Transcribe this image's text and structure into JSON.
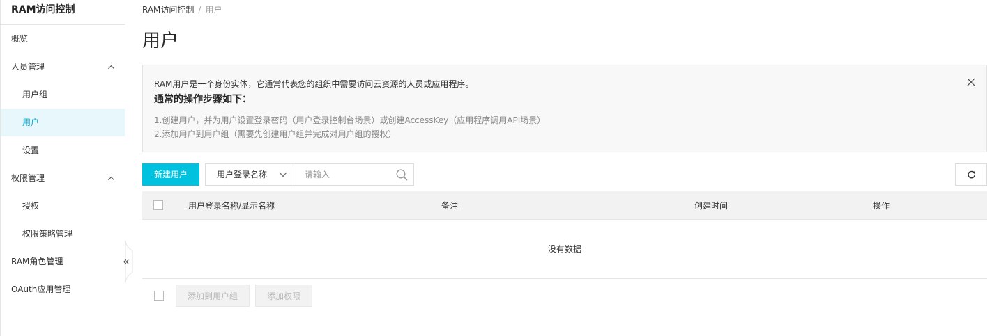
{
  "sidebar": {
    "title": "RAM访问控制",
    "items": [
      {
        "label": "概览"
      },
      {
        "label": "人员管理"
      },
      {
        "label": "用户组"
      },
      {
        "label": "用户"
      },
      {
        "label": "设置"
      },
      {
        "label": "权限管理"
      },
      {
        "label": "授权"
      },
      {
        "label": "权限策略管理"
      },
      {
        "label": "RAM角色管理"
      },
      {
        "label": "OAuth应用管理"
      }
    ],
    "collapse_glyph": "«"
  },
  "breadcrumb": {
    "root": "RAM访问控制",
    "separator": "/",
    "current": "用户"
  },
  "page": {
    "title": "用户"
  },
  "notice": {
    "description": "RAM用户是一个身份实体，它通常代表您的组织中需要访问云资源的人员或应用程序。",
    "heading": "通常的操作步骤如下：",
    "steps": [
      "1.创建用户，并为用户设置登录密码（用户登录控制台场景）或创建AccessKey（应用程序调用API场景）",
      "2.添加用户到用户组（需要先创建用户组并完成对用户组的授权）"
    ]
  },
  "toolbar": {
    "new_user": "新建用户",
    "filter_select": "用户登录名称",
    "search_placeholder": "请输入"
  },
  "table": {
    "columns": [
      "用户登录名称/显示名称",
      "备注",
      "创建时间",
      "操作"
    ],
    "empty_text": "没有数据"
  },
  "footer": {
    "add_to_group": "添加到用户组",
    "add_permission": "添加权限"
  },
  "colors": {
    "accent": "#00c1de",
    "active_bg": "#e8f7fb",
    "active_text": "#00a6cf"
  }
}
